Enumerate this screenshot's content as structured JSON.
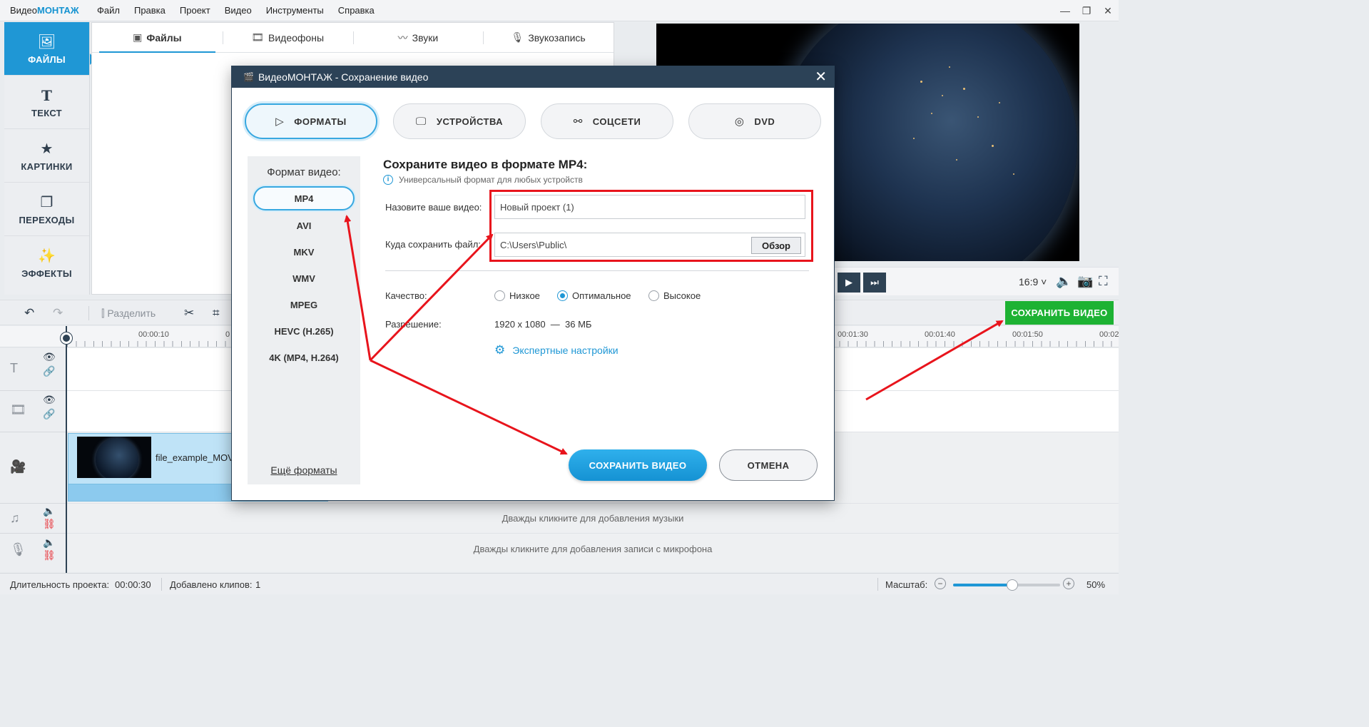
{
  "app": {
    "brand_prefix": "Видео",
    "brand_accent": "МОНТАЖ",
    "menu": [
      "Файл",
      "Правка",
      "Проект",
      "Видео",
      "Инструменты",
      "Справка"
    ],
    "window_controls": [
      "—",
      "❐",
      "✕"
    ]
  },
  "sidenav": {
    "items": [
      {
        "label": "ФАЙЛЫ",
        "icon": "image-icon",
        "glyph": "🖼",
        "active": true
      },
      {
        "label": "ТЕКСТ",
        "icon": "text-icon",
        "glyph": "T",
        "active": false
      },
      {
        "label": "КАРТИНКИ",
        "icon": "star-icon",
        "glyph": "★",
        "active": false
      },
      {
        "label": "ПЕРЕХОДЫ",
        "icon": "transitions-icon",
        "glyph": "❐",
        "active": false
      },
      {
        "label": "ЭФФЕКТЫ",
        "icon": "magic-wand-icon",
        "glyph": "✨",
        "active": false
      }
    ]
  },
  "library": {
    "tabs": [
      {
        "label": "Файлы",
        "icon": "image-icon",
        "glyph": "▣",
        "active": true
      },
      {
        "label": "Видеофоны",
        "icon": "video-bg-icon",
        "glyph": "🎞",
        "active": false
      },
      {
        "label": "Звуки",
        "icon": "sound-wave-icon",
        "glyph": "〰",
        "active": false
      },
      {
        "label": "Звукозапись",
        "icon": "microphone-icon",
        "glyph": "🎙",
        "active": false
      }
    ]
  },
  "preview": {
    "aspect": "16:9 ˅"
  },
  "toolbar": {
    "split_label": "Разделить",
    "save_video_label": "СОХРАНИТЬ ВИДЕО"
  },
  "timeline": {
    "ruler_left": [
      "00:00:10",
      "0"
    ],
    "ruler_right": [
      "00:01:30",
      "00:01:40",
      "00:01:50",
      "00:02"
    ],
    "clip_name": "file_example_MOV",
    "music_hint": "Дважды кликните для добавления музыки",
    "mic_hint": "Дважды кликните для добавления записи с микрофона"
  },
  "status": {
    "duration_label": "Длительность проекта:",
    "duration_value": "00:00:30",
    "clips_label": "Добавлено клипов:",
    "clips_value": "1",
    "scale_label": "Масштаб:",
    "zoom_percent": "50%",
    "zoom_level": 0.55
  },
  "dialog": {
    "title": "ВидеоМОНТАЖ - Сохранение видео",
    "tabs": [
      {
        "label": "ФОРМАТЫ",
        "icon": "play-file-icon",
        "glyph": "▷",
        "active": true
      },
      {
        "label": "УСТРОЙСТВА",
        "icon": "device-icon",
        "glyph": "🖵",
        "active": false
      },
      {
        "label": "СОЦСЕТИ",
        "icon": "share-icon",
        "glyph": "⚯",
        "active": false
      },
      {
        "label": "DVD",
        "icon": "disc-icon",
        "glyph": "◎",
        "active": false
      }
    ],
    "formats_title": "Формат видео:",
    "formats": [
      "MP4",
      "AVI",
      "MKV",
      "WMV",
      "MPEG",
      "HEVC (H.265)",
      "4K (MP4, H.264)"
    ],
    "active_format": "MP4",
    "more_formats": "Ещё форматы",
    "heading": "Сохраните видео в формате MP4:",
    "subheading": "Универсальный формат для любых устройств",
    "name_label": "Назовите ваше видео:",
    "name_value": "Новый проект (1)",
    "path_label": "Куда сохранить файл:",
    "path_value": "C:\\Users\\Public\\",
    "browse_label": "Обзор",
    "quality_label": "Качество:",
    "quality_options": [
      {
        "label": "Низкое",
        "checked": false
      },
      {
        "label": "Оптимальное",
        "checked": true
      },
      {
        "label": "Высокое",
        "checked": false
      }
    ],
    "resolution_label": "Разрешение:",
    "resolution_value": "1920 x 1080  —  36 МБ",
    "expert_label": "Экспертные настройки",
    "save_label": "СОХРАНИТЬ ВИДЕО",
    "cancel_label": "ОТМЕНА"
  },
  "colors": {
    "accent": "#1f97d5",
    "save_green": "#1db233",
    "annotation_red": "#e8141c",
    "dialog_header": "#2c4257"
  }
}
